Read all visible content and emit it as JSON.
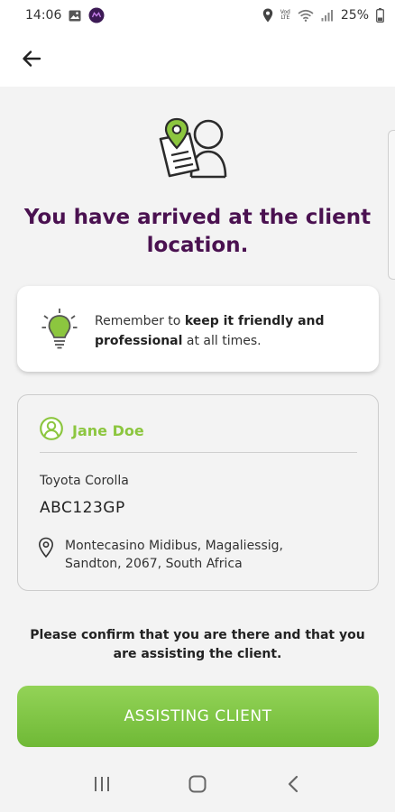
{
  "status_bar": {
    "time": "14:06",
    "network_label_top": "Vod",
    "network_label_bottom": "LTE",
    "battery": "25%"
  },
  "header": {
    "back_icon": "arrow-left-icon"
  },
  "hero": {
    "illustration": "location-person-document-icon",
    "title": "You have arrived at the client location."
  },
  "tip": {
    "icon": "lightbulb-icon",
    "prefix": "Remember to ",
    "bold_a": "keep it friendly and professional",
    "suffix": " at all times."
  },
  "client": {
    "avatar_icon": "user-circle-icon",
    "name": "Jane Doe",
    "vehicle": "Toyota Corolla",
    "plate": "ABC123GP",
    "address_icon": "location-pin-icon",
    "address": "Montecasino Midibus, Magaliessig, Sandton, 2067, South Africa"
  },
  "confirm": {
    "text": "Please confirm that you are there and that you are assisting the client.",
    "button_label": "ASSISTING CLIENT"
  },
  "colors": {
    "brand_purple": "#4a1150",
    "accent_green": "#8cc63f",
    "background": "#f3f3f3"
  }
}
